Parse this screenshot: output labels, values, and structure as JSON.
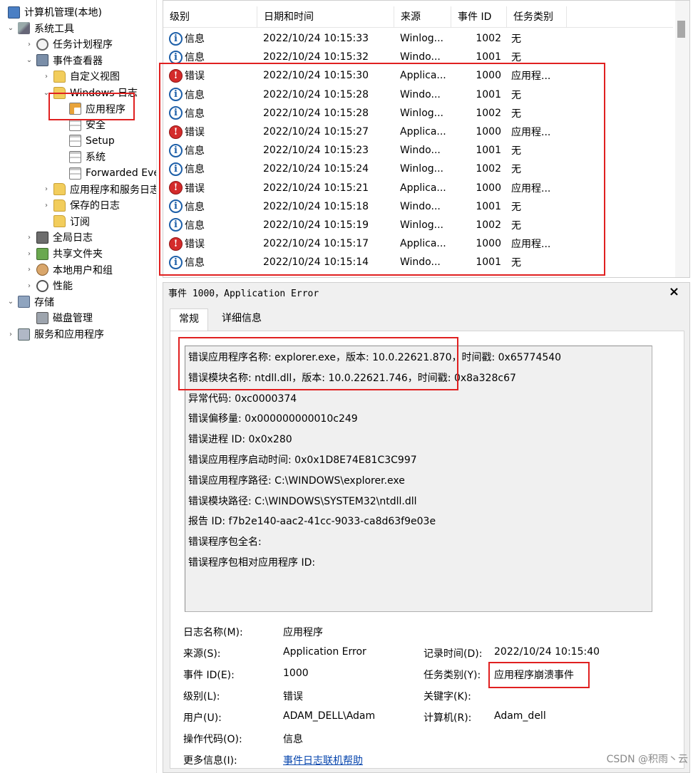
{
  "tree": [
    {
      "label": "计算机管理(本地)",
      "twist": "",
      "icon": "computer-icon",
      "depth": 0
    },
    {
      "label": "系统工具",
      "twist": "⌄",
      "icon": "tools-icon",
      "depth": 1
    },
    {
      "label": "任务计划程序",
      "twist": "›",
      "icon": "clock-icon",
      "depth": 2
    },
    {
      "label": "事件查看器",
      "twist": "⌄",
      "icon": "event-viewer-icon",
      "depth": 2
    },
    {
      "label": "自定义视图",
      "twist": "›",
      "icon": "folder-icon",
      "depth": 3
    },
    {
      "label": "Windows 日志",
      "twist": "⌄",
      "icon": "folder-icon",
      "depth": 3
    },
    {
      "label": "应用程序",
      "twist": "",
      "icon": "application-log-icon",
      "depth": 4
    },
    {
      "label": "安全",
      "twist": "",
      "icon": "log-icon",
      "depth": 4
    },
    {
      "label": "Setup",
      "twist": "",
      "icon": "log-icon",
      "depth": 4
    },
    {
      "label": "系统",
      "twist": "",
      "icon": "log-icon",
      "depth": 4
    },
    {
      "label": "Forwarded Even",
      "twist": "",
      "icon": "log-icon",
      "depth": 4
    },
    {
      "label": "应用程序和服务日志",
      "twist": "›",
      "icon": "folder-icon",
      "depth": 3
    },
    {
      "label": "保存的日志",
      "twist": "›",
      "icon": "folder-icon",
      "depth": 3
    },
    {
      "label": "订阅",
      "twist": "",
      "icon": "folder-icon",
      "depth": 3
    },
    {
      "label": "全局日志",
      "twist": "›",
      "icon": "global-log-icon",
      "depth": 2
    },
    {
      "label": "共享文件夹",
      "twist": "›",
      "icon": "shared-folder-icon",
      "depth": 2
    },
    {
      "label": "本地用户和组",
      "twist": "›",
      "icon": "users-icon",
      "depth": 2
    },
    {
      "label": "性能",
      "twist": "›",
      "icon": "performance-icon",
      "depth": 2
    },
    {
      "label": "存储",
      "twist": "⌄",
      "icon": "storage-icon",
      "depth": 1
    },
    {
      "label": "磁盘管理",
      "twist": "",
      "icon": "disk-icon",
      "depth": 2
    },
    {
      "label": "服务和应用程序",
      "twist": "›",
      "icon": "services-icon",
      "depth": 1
    }
  ],
  "list": {
    "columns": [
      "级别",
      "日期和时间",
      "来源",
      "事件 ID",
      "任务类别"
    ],
    "rows": [
      {
        "level": "信息",
        "type": "info",
        "datetime": "2022/10/24 10:15:33",
        "source": "Winlog...",
        "id": "1002",
        "category": "无"
      },
      {
        "level": "信息",
        "type": "info",
        "datetime": "2022/10/24 10:15:32",
        "source": "Windo...",
        "id": "1001",
        "category": "无"
      },
      {
        "level": "错误",
        "type": "error",
        "datetime": "2022/10/24 10:15:30",
        "source": "Applica...",
        "id": "1000",
        "category": "应用程..."
      },
      {
        "level": "信息",
        "type": "info",
        "datetime": "2022/10/24 10:15:28",
        "source": "Windo...",
        "id": "1001",
        "category": "无"
      },
      {
        "level": "信息",
        "type": "info",
        "datetime": "2022/10/24 10:15:28",
        "source": "Winlog...",
        "id": "1002",
        "category": "无"
      },
      {
        "level": "错误",
        "type": "error",
        "datetime": "2022/10/24 10:15:27",
        "source": "Applica...",
        "id": "1000",
        "category": "应用程..."
      },
      {
        "level": "信息",
        "type": "info",
        "datetime": "2022/10/24 10:15:23",
        "source": "Windo...",
        "id": "1001",
        "category": "无"
      },
      {
        "level": "信息",
        "type": "info",
        "datetime": "2022/10/24 10:15:24",
        "source": "Winlog...",
        "id": "1002",
        "category": "无"
      },
      {
        "level": "错误",
        "type": "error",
        "datetime": "2022/10/24 10:15:21",
        "source": "Applica...",
        "id": "1000",
        "category": "应用程..."
      },
      {
        "level": "信息",
        "type": "info",
        "datetime": "2022/10/24 10:15:18",
        "source": "Windo...",
        "id": "1001",
        "category": "无"
      },
      {
        "level": "信息",
        "type": "info",
        "datetime": "2022/10/24 10:15:19",
        "source": "Winlog...",
        "id": "1002",
        "category": "无"
      },
      {
        "level": "错误",
        "type": "error",
        "datetime": "2022/10/24 10:15:17",
        "source": "Applica...",
        "id": "1000",
        "category": "应用程..."
      },
      {
        "level": "信息",
        "type": "info",
        "datetime": "2022/10/24 10:15:14",
        "source": "Windo...",
        "id": "1001",
        "category": "无"
      }
    ]
  },
  "detail": {
    "title": "事件 1000，Application Error",
    "close_label": "×",
    "tabs": [
      "常规",
      "详细信息"
    ],
    "description_lines": [
      "错误应用程序名称: explorer.exe，版本: 10.0.22621.870，时间戳: 0x65774540",
      "错误模块名称: ntdll.dll，版本: 10.0.22621.746，时间戳: 0x8a328c67",
      "异常代码: 0xc0000374",
      "错误偏移量: 0x000000000010c249",
      "错误进程 ID: 0x0x280",
      "错误应用程序启动时间: 0x0x1D8E74E81C3C997",
      "错误应用程序路径: C:\\WINDOWS\\explorer.exe",
      "错误模块路径: C:\\WINDOWS\\SYSTEM32\\ntdll.dll",
      "报告 ID: f7b2e140-aac2-41cc-9033-ca8d63f9e03e",
      "错误程序包全名:",
      "错误程序包相对应用程序 ID:"
    ],
    "props": {
      "log_name_label": "日志名称(M):",
      "log_name": "应用程序",
      "source_label": "来源(S):",
      "source": "Application Error",
      "logged_label": "记录时间(D):",
      "logged": "2022/10/24 10:15:40",
      "event_id_label": "事件 ID(E):",
      "event_id": "1000",
      "task_label": "任务类别(Y):",
      "task": "应用程序崩溃事件",
      "level_label": "级别(L):",
      "level": "错误",
      "keywords_label": "关键字(K):",
      "user_label": "用户(U):",
      "user": "ADAM_DELL\\Adam",
      "computer_label": "计算机(R):",
      "computer": "Adam_dell",
      "opcode_label": "操作代码(O):",
      "opcode": "信息",
      "more_info_label": "更多信息(I):",
      "more_info_link": "事件日志联机帮助"
    }
  },
  "watermark": "CSDN @积雨丶云"
}
